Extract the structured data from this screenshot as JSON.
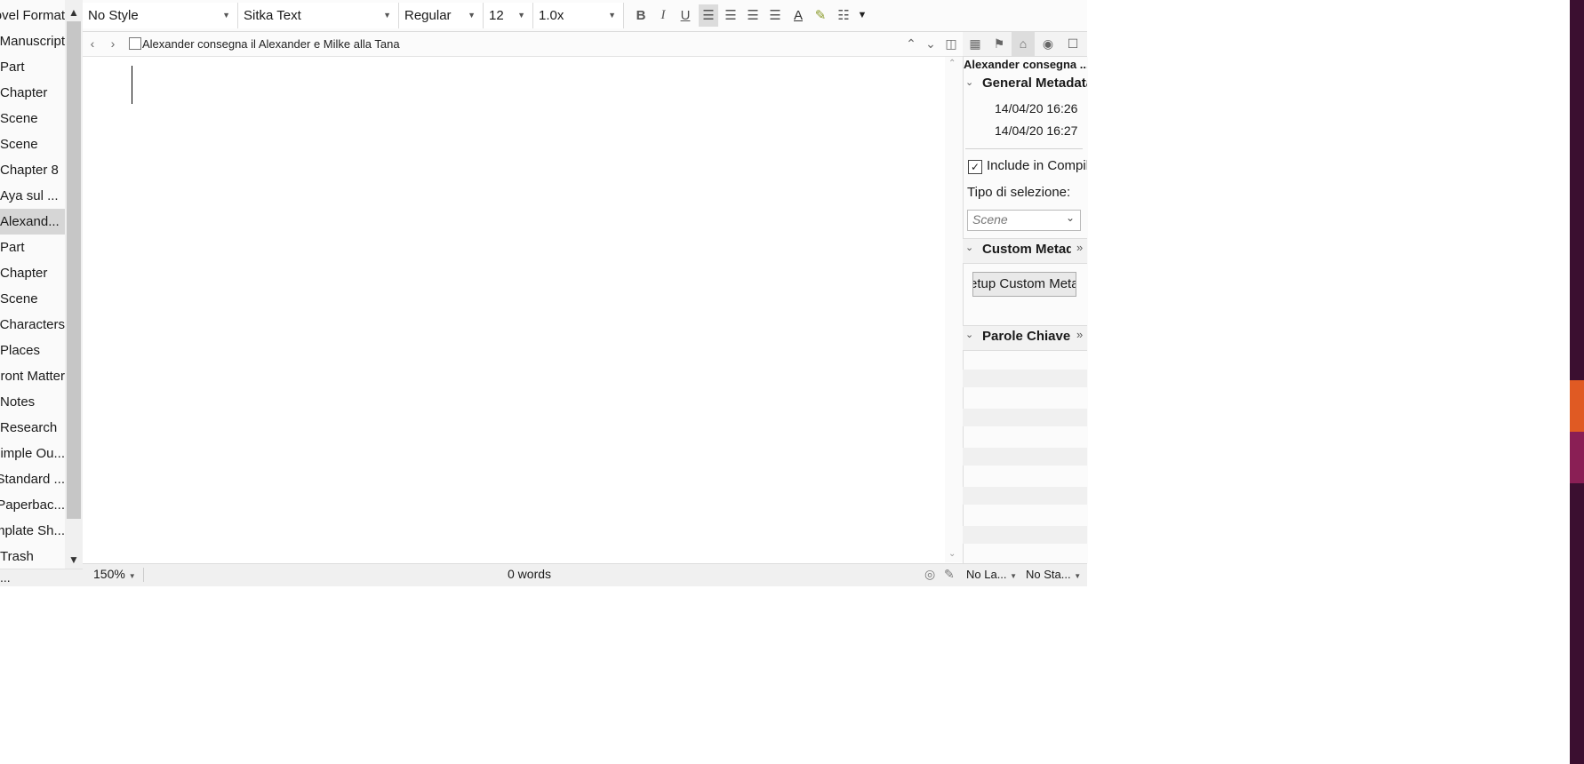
{
  "binder": {
    "items": [
      {
        "label": "Novel Format"
      },
      {
        "label": "Manuscript"
      },
      {
        "label": "Part"
      },
      {
        "label": "Chapter"
      },
      {
        "label": "Scene"
      },
      {
        "label": "Scene"
      },
      {
        "label": "Chapter 8"
      },
      {
        "label": "Aya sul ..."
      },
      {
        "label": "Alexand..."
      },
      {
        "label": "Part"
      },
      {
        "label": "Chapter"
      },
      {
        "label": "Scene"
      },
      {
        "label": "Characters"
      },
      {
        "label": "Places"
      },
      {
        "label": "Front Matter"
      },
      {
        "label": "Notes"
      },
      {
        "label": "Research"
      },
      {
        "label": "Simple Ou..."
      },
      {
        "label": "Standard ..."
      },
      {
        "label": "Paperbac..."
      },
      {
        "label": "Template Sh..."
      },
      {
        "label": "Trash"
      }
    ],
    "footer": "..."
  },
  "formatbar": {
    "style": "No Style",
    "font": "Sitka Text",
    "weight": "Regular",
    "size": "12",
    "spacing": "1.0x",
    "bold": "B",
    "italic": "I",
    "underline": "U"
  },
  "editor": {
    "document_title": "Alexander consegna il Alexander e Milke alla Tana",
    "zoom": "150%",
    "word_count": "0 words"
  },
  "inspector": {
    "title": "Alexander consegna ...",
    "general_metadata": "General Metadata",
    "created": "14/04/20 16:26",
    "modified": "14/04/20 16:27",
    "include_in_compile": "Include in Compile",
    "selection_type_label": "Tipo di selezione:",
    "selection_type_value": "Scene",
    "custom_metadata": "Custom Metadata",
    "custom_metadata_button": "Setup Custom Metadata",
    "keywords": "Parole Chiave",
    "label": "No La...",
    "status": "No Sta..."
  },
  "colors": {
    "desktop": "#3b0f30",
    "accent_orange": "#e05a23",
    "accent_pink": "#8a1f55"
  }
}
